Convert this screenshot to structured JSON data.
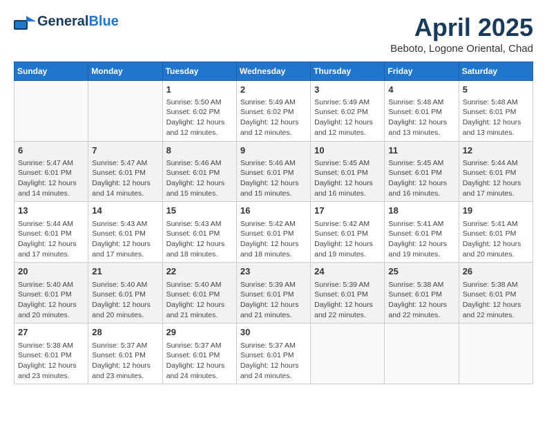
{
  "header": {
    "logo_general": "General",
    "logo_blue": "Blue",
    "month_title": "April 2025",
    "location": "Beboto, Logone Oriental, Chad"
  },
  "columns": [
    "Sunday",
    "Monday",
    "Tuesday",
    "Wednesday",
    "Thursday",
    "Friday",
    "Saturday"
  ],
  "weeks": [
    [
      {
        "day": "",
        "info": ""
      },
      {
        "day": "",
        "info": ""
      },
      {
        "day": "1",
        "info": "Sunrise: 5:50 AM\nSunset: 6:02 PM\nDaylight: 12 hours\nand 12 minutes."
      },
      {
        "day": "2",
        "info": "Sunrise: 5:49 AM\nSunset: 6:02 PM\nDaylight: 12 hours\nand 12 minutes."
      },
      {
        "day": "3",
        "info": "Sunrise: 5:49 AM\nSunset: 6:02 PM\nDaylight: 12 hours\nand 12 minutes."
      },
      {
        "day": "4",
        "info": "Sunrise: 5:48 AM\nSunset: 6:01 PM\nDaylight: 12 hours\nand 13 minutes."
      },
      {
        "day": "5",
        "info": "Sunrise: 5:48 AM\nSunset: 6:01 PM\nDaylight: 12 hours\nand 13 minutes."
      }
    ],
    [
      {
        "day": "6",
        "info": "Sunrise: 5:47 AM\nSunset: 6:01 PM\nDaylight: 12 hours\nand 14 minutes."
      },
      {
        "day": "7",
        "info": "Sunrise: 5:47 AM\nSunset: 6:01 PM\nDaylight: 12 hours\nand 14 minutes."
      },
      {
        "day": "8",
        "info": "Sunrise: 5:46 AM\nSunset: 6:01 PM\nDaylight: 12 hours\nand 15 minutes."
      },
      {
        "day": "9",
        "info": "Sunrise: 5:46 AM\nSunset: 6:01 PM\nDaylight: 12 hours\nand 15 minutes."
      },
      {
        "day": "10",
        "info": "Sunrise: 5:45 AM\nSunset: 6:01 PM\nDaylight: 12 hours\nand 16 minutes."
      },
      {
        "day": "11",
        "info": "Sunrise: 5:45 AM\nSunset: 6:01 PM\nDaylight: 12 hours\nand 16 minutes."
      },
      {
        "day": "12",
        "info": "Sunrise: 5:44 AM\nSunset: 6:01 PM\nDaylight: 12 hours\nand 17 minutes."
      }
    ],
    [
      {
        "day": "13",
        "info": "Sunrise: 5:44 AM\nSunset: 6:01 PM\nDaylight: 12 hours\nand 17 minutes."
      },
      {
        "day": "14",
        "info": "Sunrise: 5:43 AM\nSunset: 6:01 PM\nDaylight: 12 hours\nand 17 minutes."
      },
      {
        "day": "15",
        "info": "Sunrise: 5:43 AM\nSunset: 6:01 PM\nDaylight: 12 hours\nand 18 minutes."
      },
      {
        "day": "16",
        "info": "Sunrise: 5:42 AM\nSunset: 6:01 PM\nDaylight: 12 hours\nand 18 minutes."
      },
      {
        "day": "17",
        "info": "Sunrise: 5:42 AM\nSunset: 6:01 PM\nDaylight: 12 hours\nand 19 minutes."
      },
      {
        "day": "18",
        "info": "Sunrise: 5:41 AM\nSunset: 6:01 PM\nDaylight: 12 hours\nand 19 minutes."
      },
      {
        "day": "19",
        "info": "Sunrise: 5:41 AM\nSunset: 6:01 PM\nDaylight: 12 hours\nand 20 minutes."
      }
    ],
    [
      {
        "day": "20",
        "info": "Sunrise: 5:40 AM\nSunset: 6:01 PM\nDaylight: 12 hours\nand 20 minutes."
      },
      {
        "day": "21",
        "info": "Sunrise: 5:40 AM\nSunset: 6:01 PM\nDaylight: 12 hours\nand 20 minutes."
      },
      {
        "day": "22",
        "info": "Sunrise: 5:40 AM\nSunset: 6:01 PM\nDaylight: 12 hours\nand 21 minutes."
      },
      {
        "day": "23",
        "info": "Sunrise: 5:39 AM\nSunset: 6:01 PM\nDaylight: 12 hours\nand 21 minutes."
      },
      {
        "day": "24",
        "info": "Sunrise: 5:39 AM\nSunset: 6:01 PM\nDaylight: 12 hours\nand 22 minutes."
      },
      {
        "day": "25",
        "info": "Sunrise: 5:38 AM\nSunset: 6:01 PM\nDaylight: 12 hours\nand 22 minutes."
      },
      {
        "day": "26",
        "info": "Sunrise: 5:38 AM\nSunset: 6:01 PM\nDaylight: 12 hours\nand 22 minutes."
      }
    ],
    [
      {
        "day": "27",
        "info": "Sunrise: 5:38 AM\nSunset: 6:01 PM\nDaylight: 12 hours\nand 23 minutes."
      },
      {
        "day": "28",
        "info": "Sunrise: 5:37 AM\nSunset: 6:01 PM\nDaylight: 12 hours\nand 23 minutes."
      },
      {
        "day": "29",
        "info": "Sunrise: 5:37 AM\nSunset: 6:01 PM\nDaylight: 12 hours\nand 24 minutes."
      },
      {
        "day": "30",
        "info": "Sunrise: 5:37 AM\nSunset: 6:01 PM\nDaylight: 12 hours\nand 24 minutes."
      },
      {
        "day": "",
        "info": ""
      },
      {
        "day": "",
        "info": ""
      },
      {
        "day": "",
        "info": ""
      }
    ]
  ]
}
